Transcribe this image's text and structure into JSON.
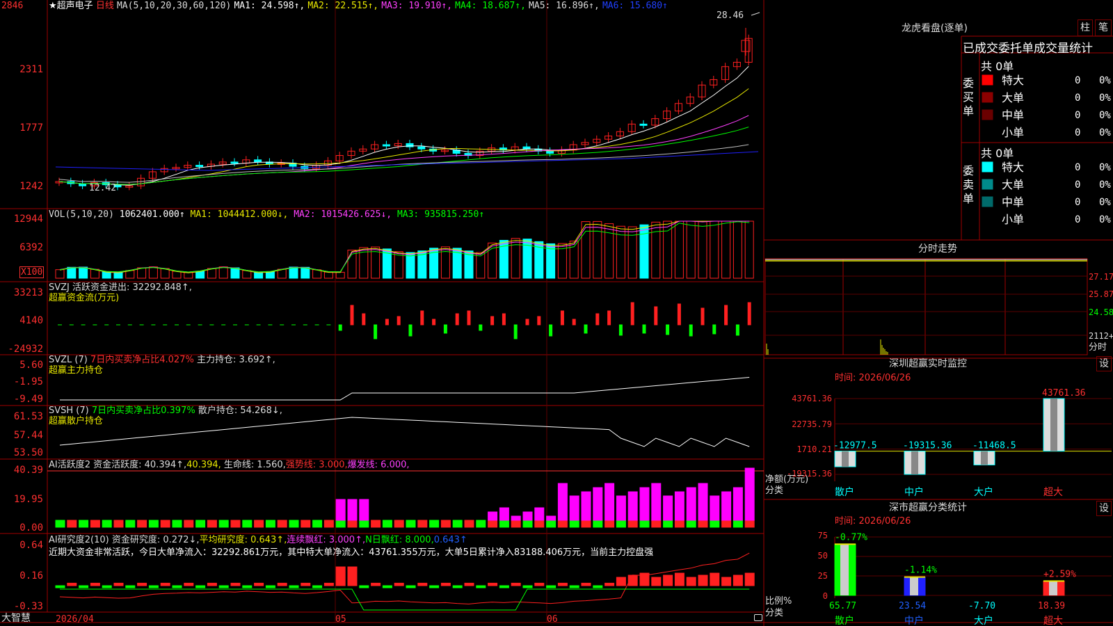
{
  "colors": {
    "up": "#ff2020",
    "down": "#00ffff",
    "frame": "#a00000",
    "bg": "#000000",
    "ma1": "#ffffff",
    "ma2": "#e8e800",
    "ma3": "#ff40ff",
    "ma4": "#00ff00",
    "ma5": "#c0c0c0",
    "ma6": "#2020ff"
  },
  "main": {
    "star": "★",
    "name": "超声电子",
    "period": "日线",
    "ma_label": "MA(5,10,20,30,60,120)",
    "ma1": "MA1: 24.598↑,",
    "ma2": "MA2: 22.515↑,",
    "ma3": "MA3: 19.910↑,",
    "ma4": "MA4: 18.687↑,",
    "ma5": "MA5: 16.896↑,",
    "ma6": "MA6: 15.680↑",
    "y_ticks": [
      "2846",
      "2311",
      "1777",
      "1242"
    ],
    "high_label": "28.46",
    "low_label": "12.42"
  },
  "vol": {
    "label": "VOL(5,10,20)",
    "value": "1062401.000↑",
    "ma1": "MA1: 1044412.000↓,",
    "ma2": "MA2: 1015426.625↓,",
    "ma3": "MA3: 935815.250↑",
    "y_ticks": [
      "12944",
      "6392"
    ],
    "unit": "X100"
  },
  "svzj": {
    "label": "SVZJ  活跃资金进出: 32292.848↑,",
    "sub": "超赢资金流(万元)",
    "y_ticks": [
      "33213",
      "4140",
      "-24932"
    ]
  },
  "svzl": {
    "label1": "SVZL (7) ",
    "label2": "7日内买卖净占比4.027%",
    "label3": " 主力持仓: 3.692↑,",
    "sub": "超赢主力持仓",
    "y_ticks": [
      "5.60",
      "-1.95",
      "-9.49"
    ]
  },
  "svsh": {
    "label1": "SVSH (7) ",
    "label2": "7日内买卖净占比0.397%",
    "label3": " 散户持仓: 54.268↓,",
    "sub": "超赢散户持仓",
    "y_ticks": [
      "61.53",
      "57.44",
      "53.50"
    ]
  },
  "ai1": {
    "label1": "AI活跃度2 资金活跃度: 40.394↑,",
    "label2": "40.394,",
    "label3": " 生命线: 1.560,",
    "label4": "强势线: 3.000,",
    "label5": "爆发线: 6.000,",
    "y_ticks": [
      "40.39",
      "19.95",
      "0.00"
    ]
  },
  "ai2": {
    "label1": "AI研究度2(10) 资金研究度: 0.272↓,",
    "label2": "平均研究度: 0.643↑,",
    "label3": "连续飘红: 3.000↑,",
    "label4": "N日飘红: 8.000,",
    "label5": "0.643↑",
    "desc": "近期大资金非常活跃，今日大单净流入：32292.861万元，其中特大单净流入：43761.355万元，大单5日累计净入83188.406万元，当前主力控盘强",
    "y_ticks": [
      "0.64",
      "0.16",
      "-0.33"
    ]
  },
  "xaxis": {
    "d1": "2026/04",
    "d2": "05",
    "d3": "06",
    "brand": "大智慧"
  },
  "dragon": {
    "title": "龙虎看盘(逐单)",
    "btn_bar": "柱",
    "btn_pen": "笔",
    "tabs": "已成交委托单成交量统计",
    "buy_total": "共 0单",
    "sell_total": "共 0单",
    "buy_side": "委买单",
    "sell_side": "委卖单",
    "buy_rows": [
      {
        "label": "特大",
        "count": "0",
        "pct": "0%",
        "color": "#ff0000"
      },
      {
        "label": "大单",
        "count": "0",
        "pct": "0%",
        "color": "#8b0000"
      },
      {
        "label": "中单",
        "count": "0",
        "pct": "0%",
        "color": "#6a0000"
      },
      {
        "label": "小单",
        "count": "0",
        "pct": "0%",
        "color": "#000000"
      }
    ],
    "sell_rows": [
      {
        "label": "特大",
        "count": "0",
        "pct": "0%",
        "color": "#00ffff"
      },
      {
        "label": "大单",
        "count": "0",
        "pct": "0%",
        "color": "#008b8b"
      },
      {
        "label": "中单",
        "count": "0",
        "pct": "0%",
        "color": "#006a6a"
      },
      {
        "label": "小单",
        "count": "0",
        "pct": "0%",
        "color": "#000000"
      }
    ]
  },
  "minute": {
    "title": "分时走势",
    "y_ticks": [
      "27.17",
      "25.87",
      "24.58",
      "2112+"
    ],
    "unit": "分时"
  },
  "sz_monitor": {
    "title": "深圳超赢实时监控",
    "btn": "设",
    "time": "时间: 2026/06/26",
    "y_ticks": [
      "43761.36",
      "22735.79",
      "1710.21",
      "-19315.36"
    ],
    "ylabel1": "净额(万元)",
    "ylabel2": "分类",
    "bars": [
      {
        "cat": "散户",
        "value": "-12977.5"
      },
      {
        "cat": "中户",
        "value": "-19315.36"
      },
      {
        "cat": "大户",
        "value": "-11468.5"
      },
      {
        "cat": "超大",
        "value": "43761.36"
      }
    ]
  },
  "sz_stats": {
    "title": "深市超赢分类统计",
    "btn": "设",
    "time": "时间: 2026/06/26",
    "y_ticks": [
      "75",
      "50",
      "25",
      "0"
    ],
    "ylabel1": "比例%",
    "ylabel2": "分类",
    "bars": [
      {
        "cat": "散户",
        "pct": "65.77",
        "chg": "-0.77%"
      },
      {
        "cat": "中户",
        "pct": "23.54",
        "chg": "-1.14%"
      },
      {
        "cat": "大户",
        "pct": "-7.70",
        "chg": ""
      },
      {
        "cat": "超大",
        "pct": "18.39",
        "chg": "+2.59%"
      }
    ]
  },
  "chart_data": {
    "type": "bar",
    "title": "深圳超赢实时监控",
    "ylabel": "净额(万元)",
    "xlabel": "分类",
    "categories": [
      "散户",
      "中户",
      "大户",
      "超大"
    ],
    "values": [
      -12977.5,
      -19315.36,
      -11468.5,
      43761.36
    ],
    "ylim": [
      -19315.36,
      43761.36
    ]
  }
}
